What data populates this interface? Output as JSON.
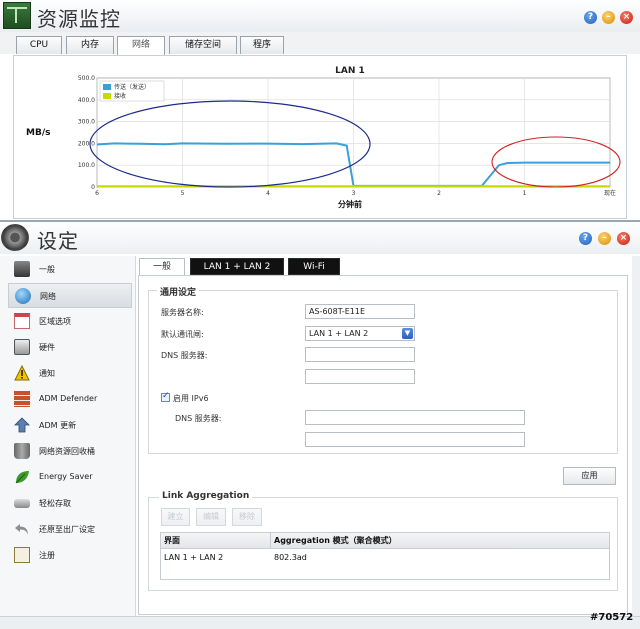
{
  "resource_monitor": {
    "title": "资源监控",
    "tabs": [
      {
        "label": "CPU"
      },
      {
        "label": "内存"
      },
      {
        "label": "网络"
      },
      {
        "label": "储存空间"
      },
      {
        "label": "程序"
      }
    ],
    "active_tab": "网络"
  },
  "chart_data": {
    "type": "line",
    "title": "LAN 1",
    "xlabel": "分钟前",
    "ylabel": "MB/s",
    "x_ticks": [
      "6",
      "5",
      "4",
      "3",
      "2",
      "1",
      "现在"
    ],
    "y_ticks": [
      "0",
      "100.0",
      "200.0",
      "300.0",
      "400.0",
      "500.0"
    ],
    "ylim": [
      0,
      500
    ],
    "xlim": [
      6,
      0
    ],
    "legend_position": "top-left",
    "grid": true,
    "series": [
      {
        "name": "传送（发送）",
        "color": "#3aa0d8",
        "x": [
          6,
          5.8,
          5.5,
          5.2,
          5.0,
          4.5,
          4.0,
          3.6,
          3.2,
          3.08,
          3.0,
          2.6,
          2.0,
          1.6,
          1.5,
          1.3,
          1.2,
          1.0,
          0.5,
          0.0
        ],
        "y": [
          195,
          200,
          198,
          196,
          200,
          198,
          199,
          197,
          200,
          190,
          5,
          5,
          5,
          5,
          5,
          100,
          110,
          112,
          112,
          112
        ]
      },
      {
        "name": "接收",
        "color": "#c8d800",
        "x": [
          6,
          0
        ],
        "y": [
          3,
          3
        ]
      }
    ]
  },
  "settings": {
    "title": "设定",
    "sidebar": {
      "items": [
        {
          "label": "一般",
          "icon": "server-icon"
        },
        {
          "label": "网络",
          "icon": "globe-icon"
        },
        {
          "label": "区域选项",
          "icon": "calendar-icon"
        },
        {
          "label": "硬件",
          "icon": "hard-drive-icon"
        },
        {
          "label": "通知",
          "icon": "warning-icon"
        },
        {
          "label": "ADM Defender",
          "icon": "brick-wall-icon"
        },
        {
          "label": "ADM 更新",
          "icon": "update-arrow-icon"
        },
        {
          "label": "网络资源回收桶",
          "icon": "recycle-bin-icon"
        },
        {
          "label": "Energy Saver",
          "icon": "leaf-icon"
        },
        {
          "label": "轻松存取",
          "icon": "easy-access-icon"
        },
        {
          "label": "还原至出厂设定",
          "icon": "undo-icon"
        },
        {
          "label": "注册",
          "icon": "register-icon"
        }
      ],
      "active": "网络"
    },
    "tabs": [
      {
        "label": "一般"
      },
      {
        "label": "LAN 1 + LAN 2"
      },
      {
        "label": "Wi-Fi"
      }
    ],
    "general_section": {
      "legend": "通用设定",
      "server_name_label": "服务器名称:",
      "server_name_value": "AS-608T-E11E",
      "default_gateway_label": "默认通讯闸:",
      "default_gateway_value": "LAN 1 + LAN 2",
      "dns_label": "DNS 服务器:",
      "dns_value_1": "",
      "dns_value_2": "",
      "ipv6_label": "启用 IPv6",
      "ipv6_enabled": true,
      "ipv6_dns_label": "DNS 服务器:",
      "ipv6_dns_value_1": "",
      "ipv6_dns_value_2": "",
      "apply_label": "应用"
    },
    "link_aggregation": {
      "legend": "Link Aggregation",
      "buttons": [
        "建立",
        "编辑",
        "移除"
      ],
      "columns": [
        "界面",
        "Aggregation 模式（聚合模式）"
      ],
      "rows": [
        [
          "LAN 1 + LAN 2",
          "802.3ad"
        ]
      ]
    }
  },
  "watermark": "#70572"
}
